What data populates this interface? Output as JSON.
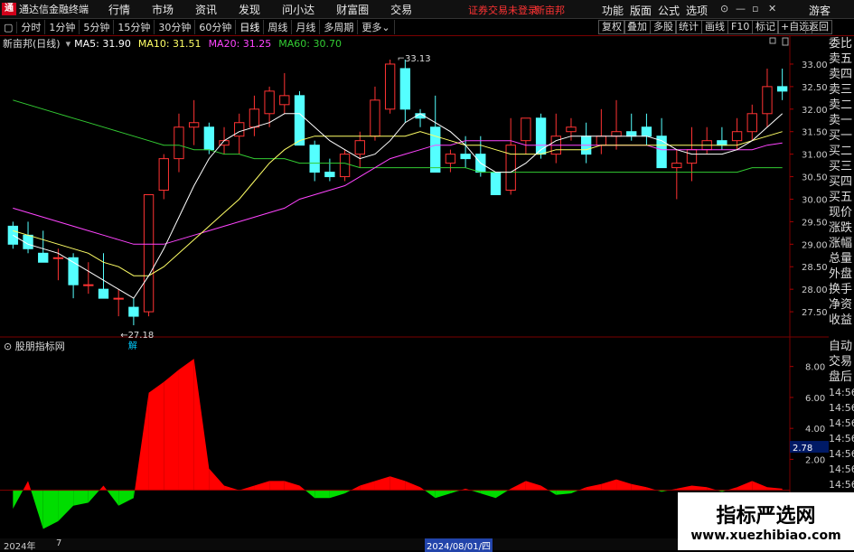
{
  "menubar": {
    "brand": "通达信金融终端",
    "items": [
      "行情",
      "市场",
      "资讯",
      "发现",
      "问小达",
      "财富圈",
      "交易"
    ],
    "warning": "证券交易未登录",
    "symbol": "新亩邦",
    "right_items": [
      "功能",
      "版面",
      "公式",
      "选项"
    ],
    "user": "游客"
  },
  "toolbar": {
    "periods": [
      "分时",
      "1分钟",
      "5分钟",
      "15分钟",
      "30分钟",
      "60分钟",
      "日线",
      "周线",
      "月线",
      "多周期",
      "更多"
    ],
    "active": "日线",
    "right_buttons": [
      "复权",
      "叠加",
      "多股",
      "统计",
      "画线",
      "F10",
      "标记",
      "+自选",
      "返回"
    ]
  },
  "info": {
    "title": "新亩邦(日线)",
    "ma5": "MA5: 31.90",
    "ma10": "MA10: 31.51",
    "ma20": "MA20: 31.25",
    "ma60": "MA60: 30.70"
  },
  "annotations": {
    "high": "33.13",
    "low": "27.18",
    "marker": "解"
  },
  "price_axis": [
    "33.00",
    "32.50",
    "32.00",
    "31.50",
    "31.00",
    "30.50",
    "30.00",
    "29.50",
    "29.00",
    "28.50",
    "28.00",
    "27.50"
  ],
  "indicator": {
    "title": "股朋指标网",
    "axis": [
      "8.00",
      "6.00",
      "4.00",
      "2.00"
    ],
    "current": "2.78"
  },
  "right_panel": [
    "委比",
    "卖五",
    "卖四",
    "卖三",
    "卖二",
    "卖一",
    "买一",
    "买二",
    "买三",
    "买四",
    "买五",
    "现价",
    "涨跌",
    "涨幅",
    "总量",
    "外盘",
    "换手",
    "净资",
    "收益"
  ],
  "right_panel_lower": [
    "自动",
    "交易",
    "盘后",
    "14:56",
    "14:56",
    "14:56",
    "14:56",
    "14:56",
    "14:56",
    "14:56",
    "14:56",
    "14:56"
  ],
  "bottom": {
    "year": "2024年",
    "month": "7",
    "date": "2024/08/01/四"
  },
  "watermark": {
    "line1": "指标严选网",
    "line2": "www.xuezhibiao.com"
  },
  "colors": {
    "up": "#ff3333",
    "down": "#54ffff",
    "ma5": "#ffffff",
    "ma10": "#ffff66",
    "ma20": "#ff44ff",
    "ma60": "#33cc33"
  },
  "chart_data": {
    "type": "candlestick",
    "ylim": [
      27.0,
      33.3
    ],
    "candles": [
      [
        29.4,
        29.5,
        28.9,
        29.0
      ],
      [
        29.2,
        29.5,
        28.8,
        28.9
      ],
      [
        28.8,
        29.3,
        28.6,
        28.6
      ],
      [
        28.7,
        28.9,
        28.2,
        28.7
      ],
      [
        28.7,
        28.8,
        27.8,
        28.1
      ],
      [
        28.1,
        28.6,
        27.9,
        28.1
      ],
      [
        28.0,
        28.8,
        27.8,
        27.8
      ],
      [
        27.8,
        28.0,
        27.4,
        27.8
      ],
      [
        27.6,
        27.8,
        27.2,
        27.4
      ],
      [
        27.5,
        30.1,
        27.4,
        30.1
      ],
      [
        30.2,
        31.0,
        30.0,
        30.9
      ],
      [
        30.9,
        31.9,
        30.6,
        31.6
      ],
      [
        31.6,
        32.2,
        31.2,
        31.7
      ],
      [
        31.6,
        31.7,
        31.0,
        31.1
      ],
      [
        31.2,
        31.6,
        31.0,
        31.3
      ],
      [
        31.4,
        31.9,
        31.0,
        31.7
      ],
      [
        31.6,
        32.3,
        31.4,
        32.0
      ],
      [
        31.9,
        32.5,
        31.6,
        32.4
      ],
      [
        32.1,
        32.8,
        31.9,
        32.3
      ],
      [
        32.3,
        32.4,
        31.2,
        31.2
      ],
      [
        31.2,
        31.3,
        30.4,
        30.6
      ],
      [
        30.6,
        30.9,
        30.4,
        30.5
      ],
      [
        30.5,
        31.1,
        30.4,
        31.0
      ],
      [
        31.0,
        31.5,
        30.7,
        31.3
      ],
      [
        31.4,
        32.5,
        31.3,
        32.2
      ],
      [
        32.0,
        33.1,
        31.9,
        33.0
      ],
      [
        32.9,
        33.1,
        31.7,
        32.0
      ],
      [
        31.9,
        32.0,
        31.6,
        31.8
      ],
      [
        31.6,
        32.3,
        30.6,
        30.6
      ],
      [
        30.8,
        31.1,
        30.6,
        31.0
      ],
      [
        31.0,
        31.4,
        30.7,
        30.9
      ],
      [
        31.0,
        31.4,
        30.5,
        30.6
      ],
      [
        30.6,
        30.6,
        30.1,
        30.1
      ],
      [
        30.2,
        31.8,
        30.1,
        31.2
      ],
      [
        31.3,
        31.8,
        31.0,
        31.8
      ],
      [
        31.8,
        31.9,
        30.9,
        31.0
      ],
      [
        31.0,
        31.9,
        30.8,
        31.4
      ],
      [
        31.5,
        31.8,
        31.3,
        31.6
      ],
      [
        31.4,
        31.7,
        30.8,
        31.0
      ],
      [
        31.2,
        32.0,
        31.0,
        31.4
      ],
      [
        31.4,
        32.2,
        31.1,
        31.5
      ],
      [
        31.5,
        31.9,
        31.3,
        31.4
      ],
      [
        31.6,
        31.9,
        31.2,
        31.4
      ],
      [
        31.4,
        31.8,
        30.8,
        30.7
      ],
      [
        30.7,
        31.1,
        30.0,
        30.8
      ],
      [
        30.8,
        31.6,
        30.4,
        31.1
      ],
      [
        31.1,
        31.6,
        31.0,
        31.3
      ],
      [
        31.3,
        31.6,
        31.1,
        31.2
      ],
      [
        31.3,
        31.8,
        31.1,
        31.5
      ],
      [
        31.5,
        32.1,
        31.3,
        31.9
      ],
      [
        31.9,
        32.9,
        31.6,
        32.5
      ],
      [
        32.5,
        32.9,
        32.2,
        32.4
      ]
    ],
    "ma5": [
      29.2,
      29.0,
      28.9,
      28.8,
      28.6,
      28.4,
      28.2,
      28.0,
      27.8,
      28.3,
      28.9,
      29.6,
      30.3,
      30.9,
      31.3,
      31.5,
      31.6,
      31.7,
      31.9,
      31.9,
      31.6,
      31.3,
      31.1,
      30.9,
      31.0,
      31.3,
      31.7,
      31.9,
      31.7,
      31.5,
      31.2,
      30.8,
      30.6,
      30.6,
      30.8,
      31.1,
      31.3,
      31.4,
      31.4,
      31.4,
      31.4,
      31.4,
      31.4,
      31.3,
      31.1,
      31.0,
      31.0,
      31.0,
      31.1,
      31.3,
      31.6,
      31.9
    ],
    "ma10": [
      29.3,
      29.2,
      29.1,
      29.0,
      28.9,
      28.8,
      28.6,
      28.5,
      28.3,
      28.3,
      28.5,
      28.8,
      29.1,
      29.4,
      29.7,
      30.0,
      30.4,
      30.8,
      31.1,
      31.3,
      31.4,
      31.4,
      31.4,
      31.4,
      31.4,
      31.4,
      31.4,
      31.5,
      31.4,
      31.3,
      31.2,
      31.2,
      31.1,
      31.0,
      31.0,
      31.0,
      31.1,
      31.1,
      31.1,
      31.2,
      31.2,
      31.2,
      31.2,
      31.2,
      31.2,
      31.2,
      31.2,
      31.2,
      31.2,
      31.3,
      31.4,
      31.5
    ],
    "ma20": [
      29.8,
      29.7,
      29.6,
      29.5,
      29.4,
      29.3,
      29.2,
      29.1,
      29.0,
      29.0,
      29.0,
      29.1,
      29.2,
      29.3,
      29.4,
      29.5,
      29.6,
      29.7,
      29.8,
      30.0,
      30.1,
      30.2,
      30.3,
      30.5,
      30.7,
      30.9,
      31.0,
      31.1,
      31.2,
      31.2,
      31.3,
      31.3,
      31.3,
      31.3,
      31.2,
      31.2,
      31.2,
      31.2,
      31.2,
      31.2,
      31.2,
      31.2,
      31.2,
      31.1,
      31.1,
      31.1,
      31.1,
      31.1,
      31.1,
      31.1,
      31.2,
      31.25
    ],
    "ma60": [
      32.2,
      32.1,
      32.0,
      31.9,
      31.8,
      31.7,
      31.6,
      31.5,
      31.4,
      31.3,
      31.2,
      31.2,
      31.1,
      31.1,
      31.0,
      31.0,
      30.9,
      30.9,
      30.9,
      30.8,
      30.8,
      30.8,
      30.8,
      30.7,
      30.7,
      30.7,
      30.7,
      30.7,
      30.7,
      30.7,
      30.7,
      30.6,
      30.6,
      30.6,
      30.6,
      30.6,
      30.6,
      30.6,
      30.6,
      30.6,
      30.6,
      30.6,
      30.6,
      30.6,
      30.6,
      30.6,
      30.6,
      30.6,
      30.6,
      30.7,
      30.7,
      30.7
    ],
    "indicator": [
      -1.2,
      0.6,
      -2.5,
      -2.0,
      -1.0,
      -0.8,
      0.3,
      -1.0,
      -0.5,
      6.3,
      7.0,
      7.8,
      8.5,
      1.4,
      0.3,
      0.0,
      0.3,
      0.6,
      0.6,
      0.3,
      -0.5,
      -0.5,
      -0.2,
      0.3,
      0.6,
      0.9,
      0.6,
      0.2,
      -0.5,
      -0.2,
      0.1,
      -0.2,
      -0.5,
      0.1,
      0.6,
      0.3,
      -0.3,
      -0.2,
      0.2,
      0.4,
      0.7,
      0.4,
      0.2,
      -0.1,
      0.1,
      0.3,
      0.2,
      -0.1,
      0.2,
      0.6,
      0.2,
      0.1
    ],
    "indicator_ylim": [
      -3,
      9.5
    ]
  }
}
